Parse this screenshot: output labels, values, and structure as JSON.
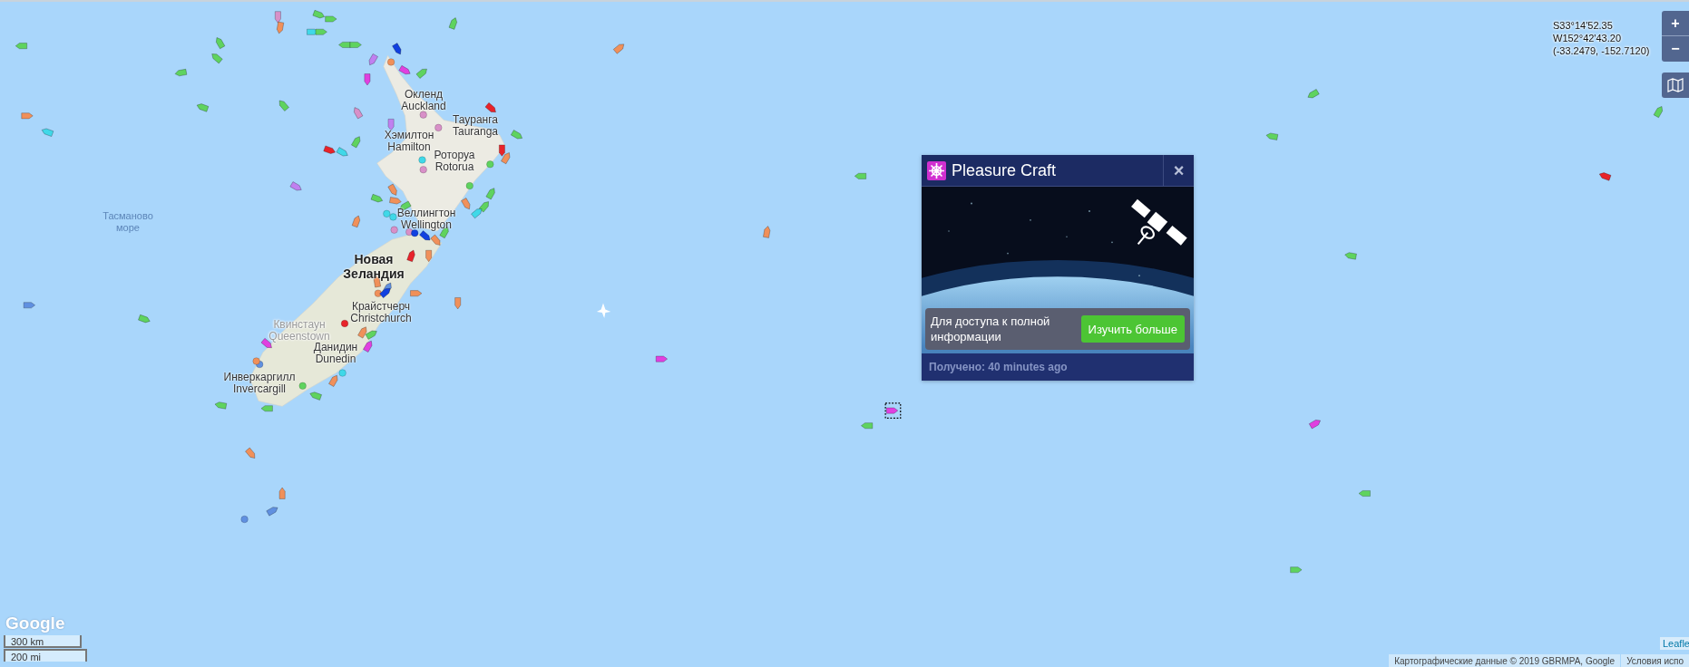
{
  "map": {
    "place_labels": [
      {
        "kind": "sea",
        "lines": [
          "Тасманово",
          "море"
        ]
      },
      {
        "kind": "city",
        "lines": [
          "Окленд",
          "Auckland"
        ]
      },
      {
        "kind": "city",
        "lines": [
          "Тауранга",
          "Tauranga"
        ]
      },
      {
        "kind": "city",
        "lines": [
          "Хэмилтон",
          "Hamilton"
        ]
      },
      {
        "kind": "city",
        "lines": [
          "Роторуа",
          "Rotorua"
        ]
      },
      {
        "kind": "city",
        "lines": [
          "Веллингтон",
          "Wellington"
        ]
      },
      {
        "kind": "country",
        "lines": [
          "Новая",
          "Зеландия"
        ]
      },
      {
        "kind": "city",
        "lines": [
          "Крайстчерч",
          "Christchurch"
        ]
      },
      {
        "kind": "faded",
        "lines": [
          "Квинстаун",
          "Queenstown"
        ]
      },
      {
        "kind": "city",
        "lines": [
          "Данидин",
          "Dunedin"
        ]
      },
      {
        "kind": "city",
        "lines": [
          "Инверкаргилл",
          "Invercargill"
        ]
      }
    ]
  },
  "coordinates": [
    "S33°14'52.35",
    "W152°42'43.20",
    "(-33.2479, -152.7120)"
  ],
  "zoom_controls": [
    "+",
    "−"
  ],
  "popup": {
    "title": "Pleasure Craft",
    "close": "×",
    "promo_text": "Для доступа к полной информации",
    "promo_button": "Изучить больше",
    "received": "Получено: 40 minutes ago"
  },
  "logo": "Google",
  "scale": [
    "300 km",
    "200 mi"
  ],
  "leaflet_link": "Leafle",
  "attribution": [
    "Картографические данные © 2019 GBRMPA, Google",
    "Условия испо"
  ]
}
